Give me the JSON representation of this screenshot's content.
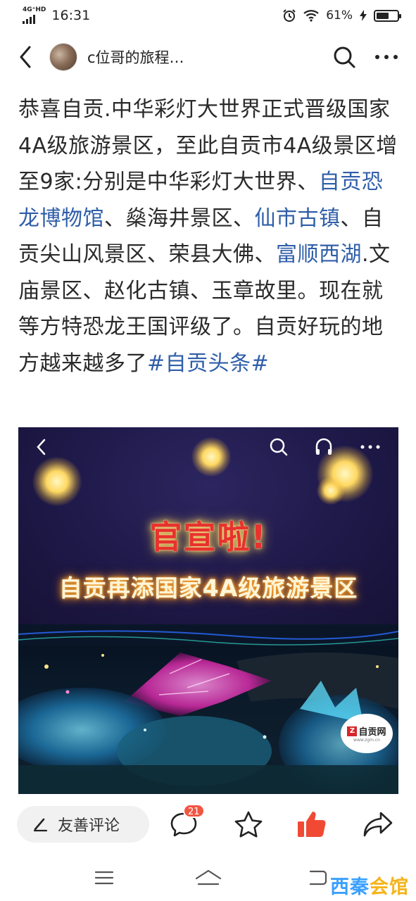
{
  "status_bar": {
    "network": "4G⁺HD",
    "time": "16:31",
    "battery_percent": "61%",
    "battery_level": 0.61
  },
  "header": {
    "channel_name": "c位哥的旅程…"
  },
  "article": {
    "segments": [
      {
        "text": "恭喜自贡.中华彩灯大世界正式晋级国家4A级旅游景区，至此自贡市4A级景区增至9家:分别是中华彩灯大世界、",
        "link": false
      },
      {
        "text": "自贡恐龙博物馆",
        "link": true
      },
      {
        "text": "、燊海井景区、",
        "link": false
      },
      {
        "text": "仙市古镇",
        "link": true
      },
      {
        "text": "、自贡尖山风景区、荣县大佛、",
        "link": false
      },
      {
        "text": "富顺西湖",
        "link": true
      },
      {
        "text": ".文庙景区、赵化古镇、玉章故里。现在就等方特恐龙王国评级了。自贡好玩的地方越来越多了",
        "link": false
      },
      {
        "text": "#自贡头条#",
        "link": true
      }
    ]
  },
  "photo": {
    "headline_main": "官宣啦!",
    "headline_sub": "自贡再添国家4A级旅游景区",
    "watermark_text": "自贡网",
    "watermark_url": "www.zgm.cn"
  },
  "action_bar": {
    "comment_placeholder": "友善评论",
    "comment_count": "21"
  },
  "site_watermark": {
    "part1": "西秦",
    "part2": "会馆"
  },
  "colors": {
    "link": "#2f5ea8",
    "like": "#f04a35",
    "badge": "#f25542"
  }
}
